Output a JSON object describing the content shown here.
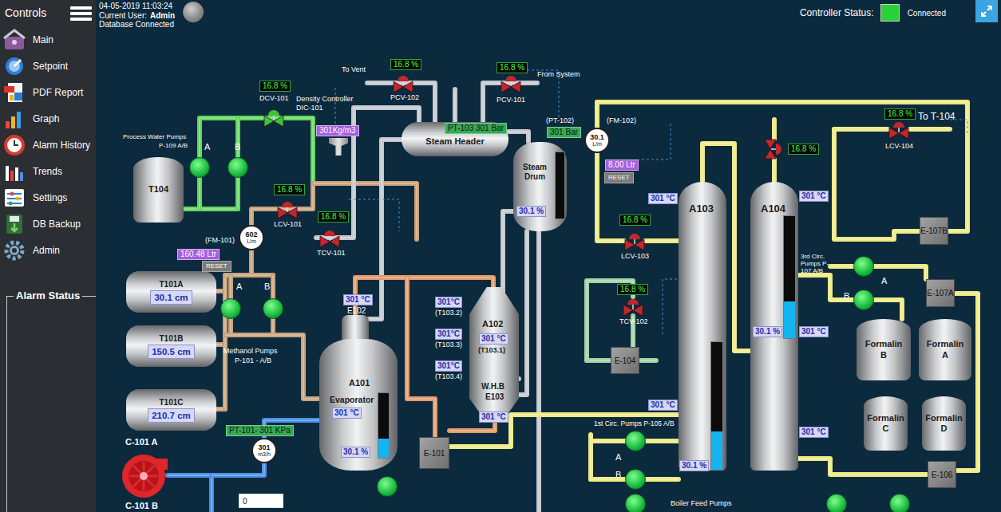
{
  "sidebar": {
    "title": "Controls",
    "items": [
      {
        "label": "Main",
        "selected": false
      },
      {
        "label": "Setpoint",
        "selected": false
      },
      {
        "label": "PDF Report",
        "selected": false
      },
      {
        "label": "Graph",
        "selected": false
      },
      {
        "label": "Alarm History",
        "selected": false
      },
      {
        "label": "Trends",
        "selected": false
      },
      {
        "label": "Settings",
        "selected": false
      },
      {
        "label": "DB Backup",
        "selected": false
      },
      {
        "label": "Admin",
        "selected": false
      }
    ],
    "alarm_title": "Alarm Status"
  },
  "header": {
    "datetime": "04-05-2019 11:03:24",
    "user_label": "Current User:",
    "user": "Admin",
    "db_status": "Database Connected",
    "controller_label": "Controller Status:",
    "controller_text": "Connected",
    "controller_connected": true
  },
  "diagram": {
    "valves": [
      {
        "tag": "PCV-102",
        "reading": "16.8 %",
        "kind": "horizontal",
        "color": "#c1272d"
      },
      {
        "tag": "PCV-101",
        "reading": "16.8 %",
        "kind": "horizontal",
        "color": "#c1272d"
      },
      {
        "tag": "DCV-101",
        "reading": "16.8 %",
        "kind": "horizontal",
        "color": "#3cc43c"
      },
      {
        "tag": "LCV-101",
        "reading": "16.8 %",
        "kind": "horizontal",
        "color": "#c1272d"
      },
      {
        "tag": "TCV-101",
        "reading": "16.8 %",
        "kind": "horizontal",
        "color": "#c1272d"
      },
      {
        "tag": "LCV-103",
        "reading": "16.8 %",
        "kind": "horizontal",
        "color": "#c1272d"
      },
      {
        "tag": "TCV-102",
        "reading": "16.8 %",
        "kind": "horizontal",
        "color": "#c1272d"
      },
      {
        "reading": "16.8 %",
        "kind": "vertical",
        "color": "#c1272d"
      },
      {
        "tag": "LCV-104",
        "reading": "16.8 %",
        "kind": "horizontal",
        "color": "#c1272d"
      }
    ],
    "steam_header": {
      "name": "Steam Header",
      "pressure": "PT-103 301 Bar"
    },
    "steam_drum": {
      "name": "Steam Drum",
      "tag": "(PT-102)",
      "pressure": "301 Bar",
      "reading": "30.1 %",
      "level": 0
    },
    "evaporator": {
      "tag": "A101",
      "name": "Evaporator",
      "top": "E102",
      "temp": "301 °C",
      "reading": "30.1 %",
      "level": 0.3
    },
    "whb": {
      "tag": "A102",
      "temp": "301 °C",
      "sensor": "(T103.1)",
      "name": "W.H.B",
      "unit": "E103",
      "outlet_temp": "301 °C"
    },
    "columns": [
      {
        "name": "A103",
        "reading": "30.1 %",
        "level": 0.3
      },
      {
        "name": "A104",
        "reading": "30.1 %",
        "level": 0.3
      }
    ],
    "tanks": [
      {
        "name": "T101A",
        "reading": "30.1 cm",
        "kind": "horizontal"
      },
      {
        "name": "T101B",
        "reading": "150.5 cm",
        "kind": "horizontal"
      },
      {
        "name": "T101C",
        "reading": "210.7 cm",
        "kind": "horizontal"
      },
      {
        "name": "T104",
        "kind": "vertical"
      },
      {
        "name": "Formalin B",
        "kind": "vertical"
      },
      {
        "name": "Formalin A",
        "kind": "vertical"
      },
      {
        "name": "Formalin C",
        "kind": "vertical"
      },
      {
        "name": "Formalin D",
        "kind": "vertical"
      }
    ],
    "exchangers": [
      {
        "name": "E-101"
      },
      {
        "name": "E-104"
      },
      {
        "name": "E-107B"
      },
      {
        "name": "E-107A"
      },
      {
        "name": "E-106"
      }
    ],
    "pumps": [
      {
        "label": "A",
        "running": true
      },
      {
        "label": "B",
        "running": true
      },
      {
        "label": "A",
        "running": true
      },
      {
        "label": "B",
        "running": true
      },
      {
        "label": "A",
        "running": true
      },
      {
        "label": "B",
        "running": true
      },
      {
        "label": "A",
        "running": true
      },
      {
        "label": "B",
        "running": true
      },
      {
        "running": true
      },
      {
        "running": true
      },
      {
        "running": true
      },
      {
        "running": true
      }
    ],
    "meters": [
      {
        "tag": "(FM-102)",
        "value": "30.1",
        "unit": "L/m",
        "total": "8.00 Ltr",
        "button": "RESET"
      },
      {
        "tag": "(FM-101)",
        "value": "602",
        "unit": "L/m",
        "total": "160.48 Ltr",
        "button": "RESET"
      },
      {
        "tag": "PT-101- 301 KPa",
        "value": "301",
        "unit": "m3/h"
      }
    ],
    "temps": [
      {
        "value": "301 °C"
      },
      {
        "value": "301°C",
        "sensor": "(T103.2)"
      },
      {
        "value": "301°C",
        "sensor": "(T103.3)"
      },
      {
        "value": "301°C",
        "sensor": "(T103.4)"
      },
      {
        "value": "301 °C"
      },
      {
        "value": "301 °C"
      },
      {
        "value": "301 °C"
      },
      {
        "value": "301 °C"
      },
      {
        "value": "301 °C"
      }
    ],
    "density": "301Kg/m3",
    "setpoint_input": "0",
    "compressor": {
      "name": "C-101 A",
      "running": false
    },
    "labels": [
      "To Vent",
      "From System",
      "Density Controller",
      "DIC-101",
      "Process Water Pumps",
      "P-109 A/B",
      "Methanol Pumps",
      "P-101 - A/B",
      "3rd Circ. Pumps P-107 A/B",
      "To T-104",
      "1st Circ. Pumps P-105 A/B",
      "Boiler Feed Pumps",
      "C-101 B"
    ]
  }
}
